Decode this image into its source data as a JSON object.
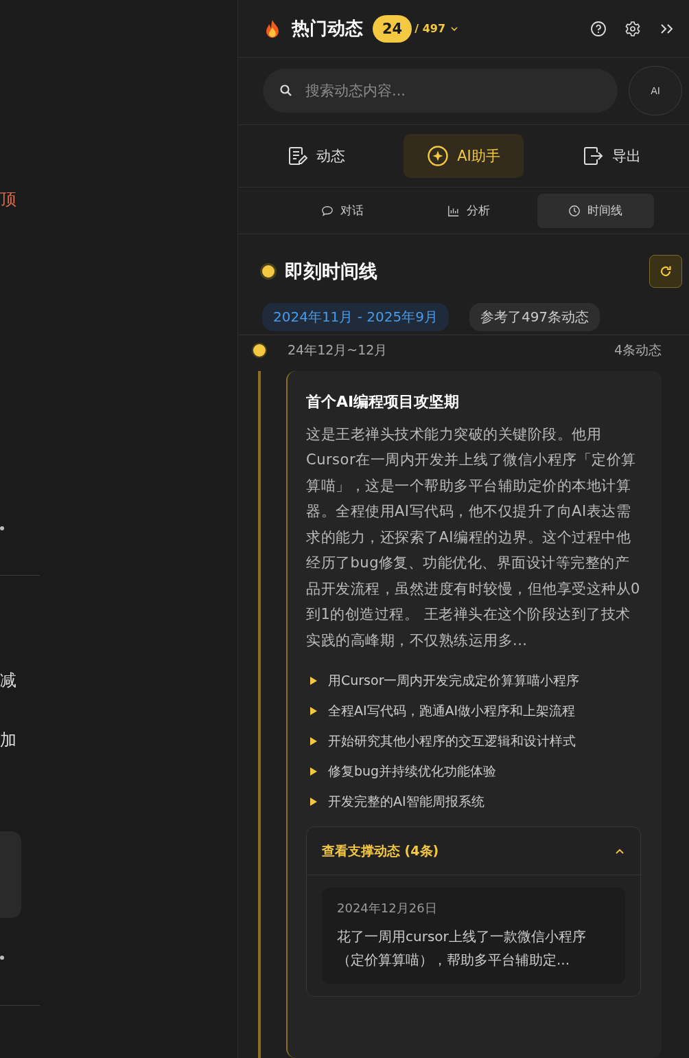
{
  "left_panel": {
    "texts": [
      "顶",
      "减",
      "加"
    ]
  },
  "header": {
    "title": "热门动态",
    "count": "24",
    "total": "/ 497"
  },
  "search": {
    "placeholder": "搜索动态内容...",
    "ai_button": "AI"
  },
  "tabs": [
    {
      "label": "动态",
      "kind": "edit",
      "selected": false
    },
    {
      "label": "AI助手",
      "kind": "sparkle",
      "selected": true
    },
    {
      "label": "导出",
      "kind": "export",
      "selected": false
    }
  ],
  "sub_tabs": [
    {
      "label": "对话",
      "kind": "chat",
      "selected": false
    },
    {
      "label": "分析",
      "kind": "chart",
      "selected": false
    },
    {
      "label": "时间线",
      "kind": "clock",
      "selected": true
    }
  ],
  "timeline": {
    "title": "即刻时间线",
    "range": "2024年11月 - 2025年9月",
    "reference": "参考了497条动态",
    "periods": [
      {
        "date": "24年12月~12月",
        "count": "4条动态",
        "card": {
          "title": "首个AI编程项目攻坚期",
          "summary": "这是王老禅头技术能力突破的关键阶段。他用Cursor在一周内开发并上线了微信小程序「定价算算喵」，这是一个帮助多平台辅助定价的本地计算器。全程使用AI写代码，他不仅提升了向AI表达需求的能力，还探索了AI编程的边界。这个过程中他经历了bug修复、功能优化、界面设计等完整的产品开发流程，虽然进度有时较慢，但他享受这种从0到1的创造过程。 王老禅头在这个阶段达到了技术实践的高峰期，不仅熟练运用多...",
          "highlights": [
            "用Cursor一周内开发完成定价算算喵小程序",
            "全程AI写代码，跑通AI做小程序和上架流程",
            "开始研究其他小程序的交互逻辑和设计样式",
            "修复bug并持续优化功能体验",
            "开发完整的AI智能周报系统"
          ],
          "support": {
            "label": "查看支撑动态 (4条)",
            "expanded": true,
            "items": [
              {
                "date": "2024年12月26日",
                "text": "花了一周用cursor上线了一款微信小程序（定价算算喵），帮助多平台辅助定..."
              }
            ]
          }
        }
      }
    ]
  }
}
